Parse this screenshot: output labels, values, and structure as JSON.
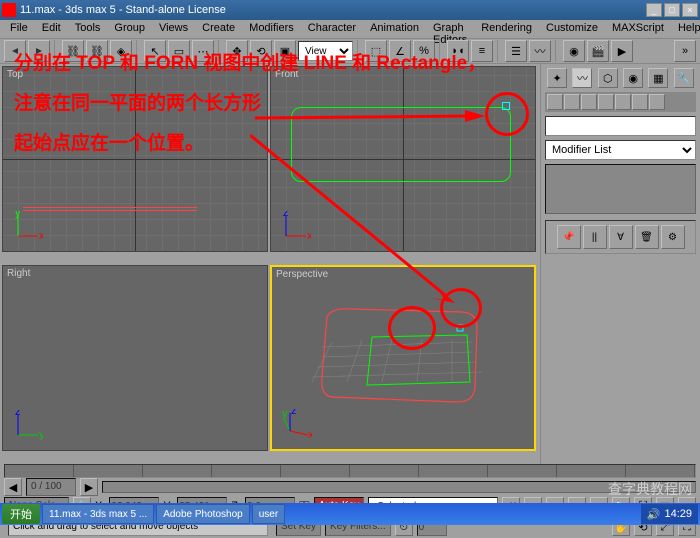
{
  "titlebar": {
    "title": "11.max - 3ds max 5 - Stand-alone License"
  },
  "menu": {
    "items": [
      "File",
      "Edit",
      "Tools",
      "Group",
      "Views",
      "Create",
      "Modifiers",
      "Character",
      "Animation",
      "Graph Editors",
      "Rendering",
      "Customize",
      "MAXScript",
      "Help"
    ]
  },
  "toolbar": {
    "dropdown": "View"
  },
  "viewports": {
    "top": "Top",
    "front": "Front",
    "right": "Right",
    "perspective": "Perspective"
  },
  "right_panel": {
    "modifier_label": "Modifier List"
  },
  "timeline": {
    "frame": "0",
    "range": "0 / 100"
  },
  "status": {
    "selection": "None Sele",
    "x_label": "X:",
    "x_val": "92.943",
    "y_label": "Y:",
    "y_val": "35.421",
    "z_label": "Z:",
    "z_val": "0.0",
    "autokey": "Auto Key",
    "selected": "Selected",
    "setkey": "Set Key",
    "keyfilters": "Key Filters...",
    "prompt": "Click and drag to select and move objects"
  },
  "taskbar": {
    "start": "开始",
    "task1": "11.max - 3ds max 5 ...",
    "task2": "Adobe Photoshop",
    "task3": "user",
    "time": "14:29"
  },
  "overlay": {
    "line1": "分别在 TOP 和 FORN 视图中创建 LINE 和 Rectangle，",
    "line2": "注意在同一平面的两个长方形",
    "line3": "起始点应在一个位置。"
  },
  "watermark": "查字典教程网"
}
